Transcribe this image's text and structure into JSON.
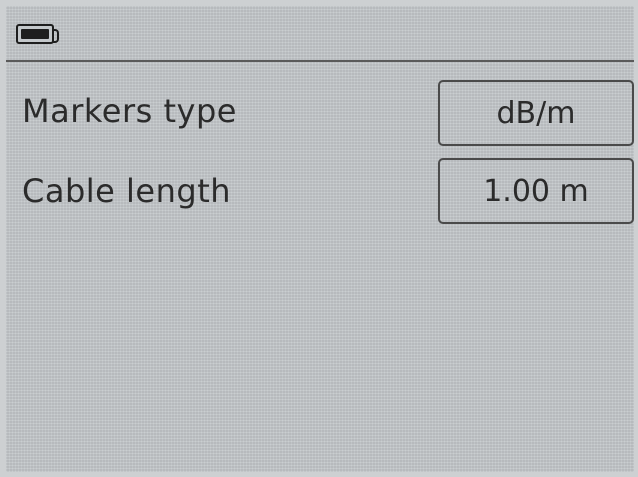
{
  "status_bar": {
    "battery_icon": "battery-icon",
    "battery_level": 1.0
  },
  "settings": [
    {
      "label": "Markers type",
      "value": "dB/m"
    },
    {
      "label": "Cable length",
      "value": "1.00 m"
    }
  ],
  "colors": {
    "screen_background": "#c4c8cb",
    "text": "#2b2b2b",
    "border": "#4a4a4a"
  }
}
